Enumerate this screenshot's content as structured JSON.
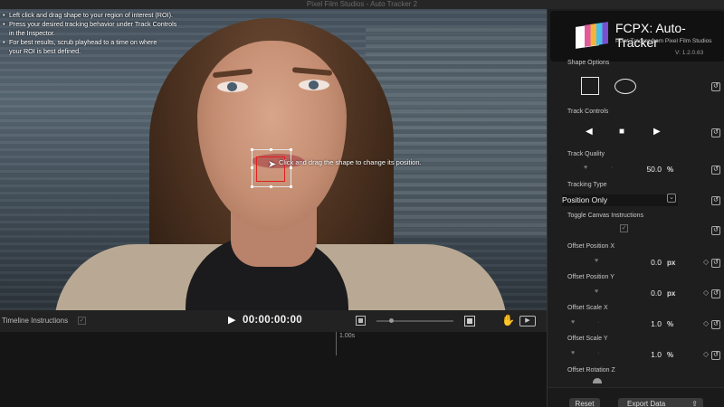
{
  "window": {
    "title": "Pixel Film Studios - Auto Tracker 2"
  },
  "viewer": {
    "instructions": [
      "Left click and drag shape to your region of interest (ROI).",
      "Press your desired tracking behavior under Track Controls",
      "in the Inspector.",
      "For best results, scrub playhead to a time on where",
      "your ROI is best defined."
    ],
    "roi_hint": "Click and drag the shape to change its position."
  },
  "transport": {
    "timeline_instructions_label": "Timeline Instructions",
    "timecode": "00:00:00:00"
  },
  "timeline": {
    "ruler_label": "1.00s"
  },
  "inspector": {
    "title": "FCPX: Auto-Tracker",
    "subtitle": "Point Tracker from Pixel Film Studios",
    "version": "V: 1.2.0.63",
    "shape_options_label": "Shape Options",
    "track_controls_label": "Track Controls",
    "track_quality": {
      "label": "Track Quality",
      "value": "50.0",
      "unit": "%"
    },
    "tracking_type": {
      "label": "Tracking Type",
      "value": "Position Only"
    },
    "toggle_canvas_label": "Toggle Canvas Instructions",
    "offset_position_x": {
      "label": "Offset Position X",
      "value": "0.0",
      "unit": "px"
    },
    "offset_position_y": {
      "label": "Offset Position Y",
      "value": "0.0",
      "unit": "px"
    },
    "offset_scale_x": {
      "label": "Offset Scale X",
      "value": "1.0",
      "unit": "%"
    },
    "offset_scale_y": {
      "label": "Offset Scale Y",
      "value": "1.0",
      "unit": "%"
    },
    "offset_rotation_z": {
      "label": "Offset Rotation Z"
    },
    "reset_button": "Reset",
    "export_button": "Export Data"
  },
  "icons": {
    "play": "play-icon",
    "reverse": "track-backward-icon",
    "stop": "stop-icon",
    "forward": "track-forward-icon",
    "reset": "reset-arrow-icon",
    "keyframe": "keyframe-diamond-icon",
    "share": "share-icon"
  }
}
